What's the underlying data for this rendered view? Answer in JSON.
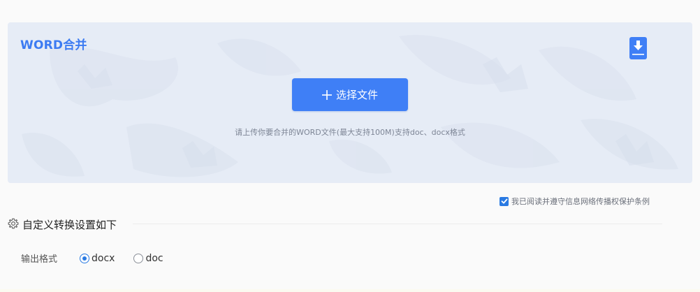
{
  "upload": {
    "title": "WORD合并",
    "select_button": "选择文件",
    "hint": "请上传你要合并的WORD文件(最大支持100M)支持doc、docx格式"
  },
  "icons": {
    "download": "download-icon",
    "plus": "plus-icon",
    "checkbox": "checkmark-icon",
    "settings": "gear-icon"
  },
  "agreement": {
    "checked": true,
    "text": "我已阅读并遵守信息网络传播权保护条例"
  },
  "settings": {
    "title": "自定义转换设置如下",
    "output_format": {
      "label": "输出格式",
      "options": [
        {
          "label": "docx",
          "selected": true
        },
        {
          "label": "doc",
          "selected": false
        }
      ]
    }
  },
  "colors": {
    "accent": "#3f7ff6",
    "title_blue": "#3c7bf2",
    "panel_bg": "#e6ecf6",
    "page_bg": "#fafafa"
  }
}
